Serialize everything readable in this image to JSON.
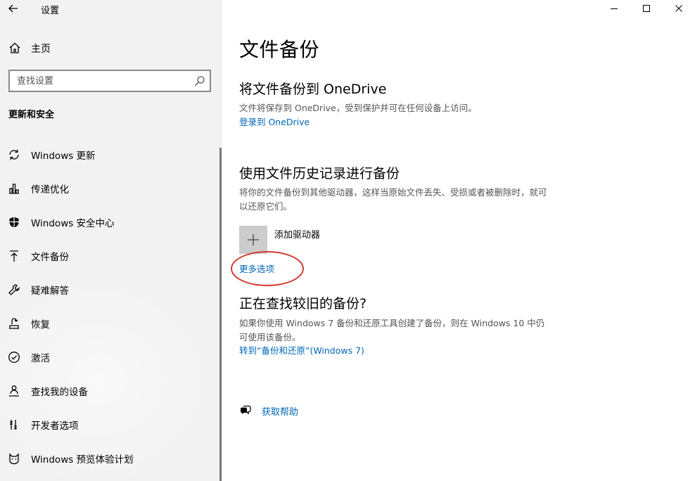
{
  "window": {
    "app_title": "设置"
  },
  "sidebar": {
    "home_label": "主页",
    "search_placeholder": "查找设置",
    "section_title": "更新和安全",
    "items": [
      {
        "label": "Windows 更新",
        "icon": "sync-icon"
      },
      {
        "label": "传递优化",
        "icon": "delivery-optimization-icon"
      },
      {
        "label": "Windows 安全中心",
        "icon": "shield-icon"
      },
      {
        "label": "文件备份",
        "icon": "backup-arrow-icon"
      },
      {
        "label": "疑难解答",
        "icon": "wrench-icon"
      },
      {
        "label": "恢复",
        "icon": "recovery-icon"
      },
      {
        "label": "激活",
        "icon": "check-circle-icon"
      },
      {
        "label": "查找我的设备",
        "icon": "person-locate-icon"
      },
      {
        "label": "开发者选项",
        "icon": "developer-tools-icon"
      },
      {
        "label": "Windows 预览体验计划",
        "icon": "cat-face-icon"
      }
    ]
  },
  "main": {
    "page_title": "文件备份",
    "onedrive": {
      "heading": "将文件备份到 OneDrive",
      "desc": "文件将保存到 OneDrive，受到保护并可在任何设备上访问。",
      "link": "登录到 OneDrive"
    },
    "file_history": {
      "heading": "使用文件历史记录进行备份",
      "desc": "将你的文件备份到其他驱动器，这样当原始文件丢失、受损或者被删除时，就可以还原它们。",
      "add_drive_label": "添加驱动器",
      "more_options_link": "更多选项"
    },
    "older_backup": {
      "heading": "正在查找较旧的备份?",
      "desc": "如果你使用 Windows 7 备份和还原工具创建了备份，则在 Windows 10 中仍可使用该备份。",
      "link": "转到“备份和还原”(Windows 7)"
    },
    "help_link": "获取帮助"
  },
  "colors": {
    "link": "#0067b8",
    "sidebar_bg": "#f2f2f2",
    "annotation": "#d23a2f"
  }
}
